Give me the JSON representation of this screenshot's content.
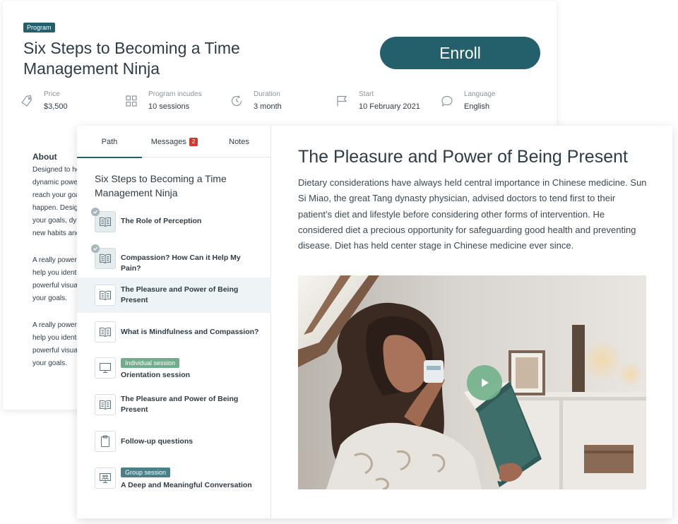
{
  "program": {
    "badge": "Program",
    "title": "Six Steps to Becoming a Time Management Ninja",
    "enroll_label": "Enroll"
  },
  "meta": [
    {
      "icon": "price-tag-icon",
      "label": "Price",
      "value": "$3,500"
    },
    {
      "icon": "grid-icon",
      "label": "Program incudes",
      "value": "10 sessions"
    },
    {
      "icon": "clock-icon",
      "label": "Duration",
      "value": "3 month"
    },
    {
      "icon": "flag-icon",
      "label": "Start",
      "value": "10 February 2021"
    },
    {
      "icon": "chat-bubble-icon",
      "label": "Language",
      "value": "English"
    }
  ],
  "about": {
    "title": "About",
    "paragraph1": [
      "Designed to he",
      "dynamic powe",
      "reach your goa",
      "happen. Design",
      "your goals, dyn",
      "new habits and"
    ],
    "paragraph2": [
      "A really powerf",
      "help you identi",
      "powerful visua",
      "your goals."
    ],
    "paragraph3": [
      "A really powerf",
      "help you identi",
      "powerful visua",
      "your goals."
    ]
  },
  "tabs": {
    "path": "Path",
    "messages": "Messages",
    "messages_count": "2",
    "notes": "Notes"
  },
  "path": {
    "title": "Six Steps to Becoming a Time Management Ninja",
    "items": [
      {
        "label": "The Role of Perception",
        "icon": "book-icon",
        "completed": true
      },
      {
        "label": "Compassion? How Can it Help My Pain?",
        "icon": "book-icon",
        "completed": true
      },
      {
        "label": "The Pleasure and Power of Being Present",
        "icon": "book-icon",
        "completed": false,
        "active": true
      },
      {
        "label": "What is Mindfulness and Compassion?",
        "icon": "book-icon",
        "completed": false
      },
      {
        "label": "Orientation session",
        "tag": "Individual session",
        "icon": "monitor-icon",
        "completed": false
      },
      {
        "label": "The Pleasure and Power of Being Present",
        "icon": "book-icon",
        "completed": false
      },
      {
        "label": "Follow-up questions",
        "icon": "clipboard-icon",
        "completed": false
      },
      {
        "label": "A Deep and Meaningful Conversation",
        "tag": "Group session",
        "icon": "group-screen-icon",
        "completed": false
      }
    ]
  },
  "content": {
    "title": "The Pleasure and Power of Being Present",
    "body": "Dietary considerations have always held central importance in Chinese medicine. Sun Si Miao, the great Tang dynasty physician, advised doctors to tend first to their patient’s diet and lifestyle before considering other forms of intervention. He considered diet a precious opportunity for safeguarding good health and preventing disease. Diet has held center stage in Chinese medicine ever since."
  },
  "colors": {
    "brand": "#24606b",
    "badge_red": "#d33a2f",
    "individual_tag": "#6fae8b",
    "group_tag": "#4b7f8a",
    "play": "#73b28c"
  }
}
